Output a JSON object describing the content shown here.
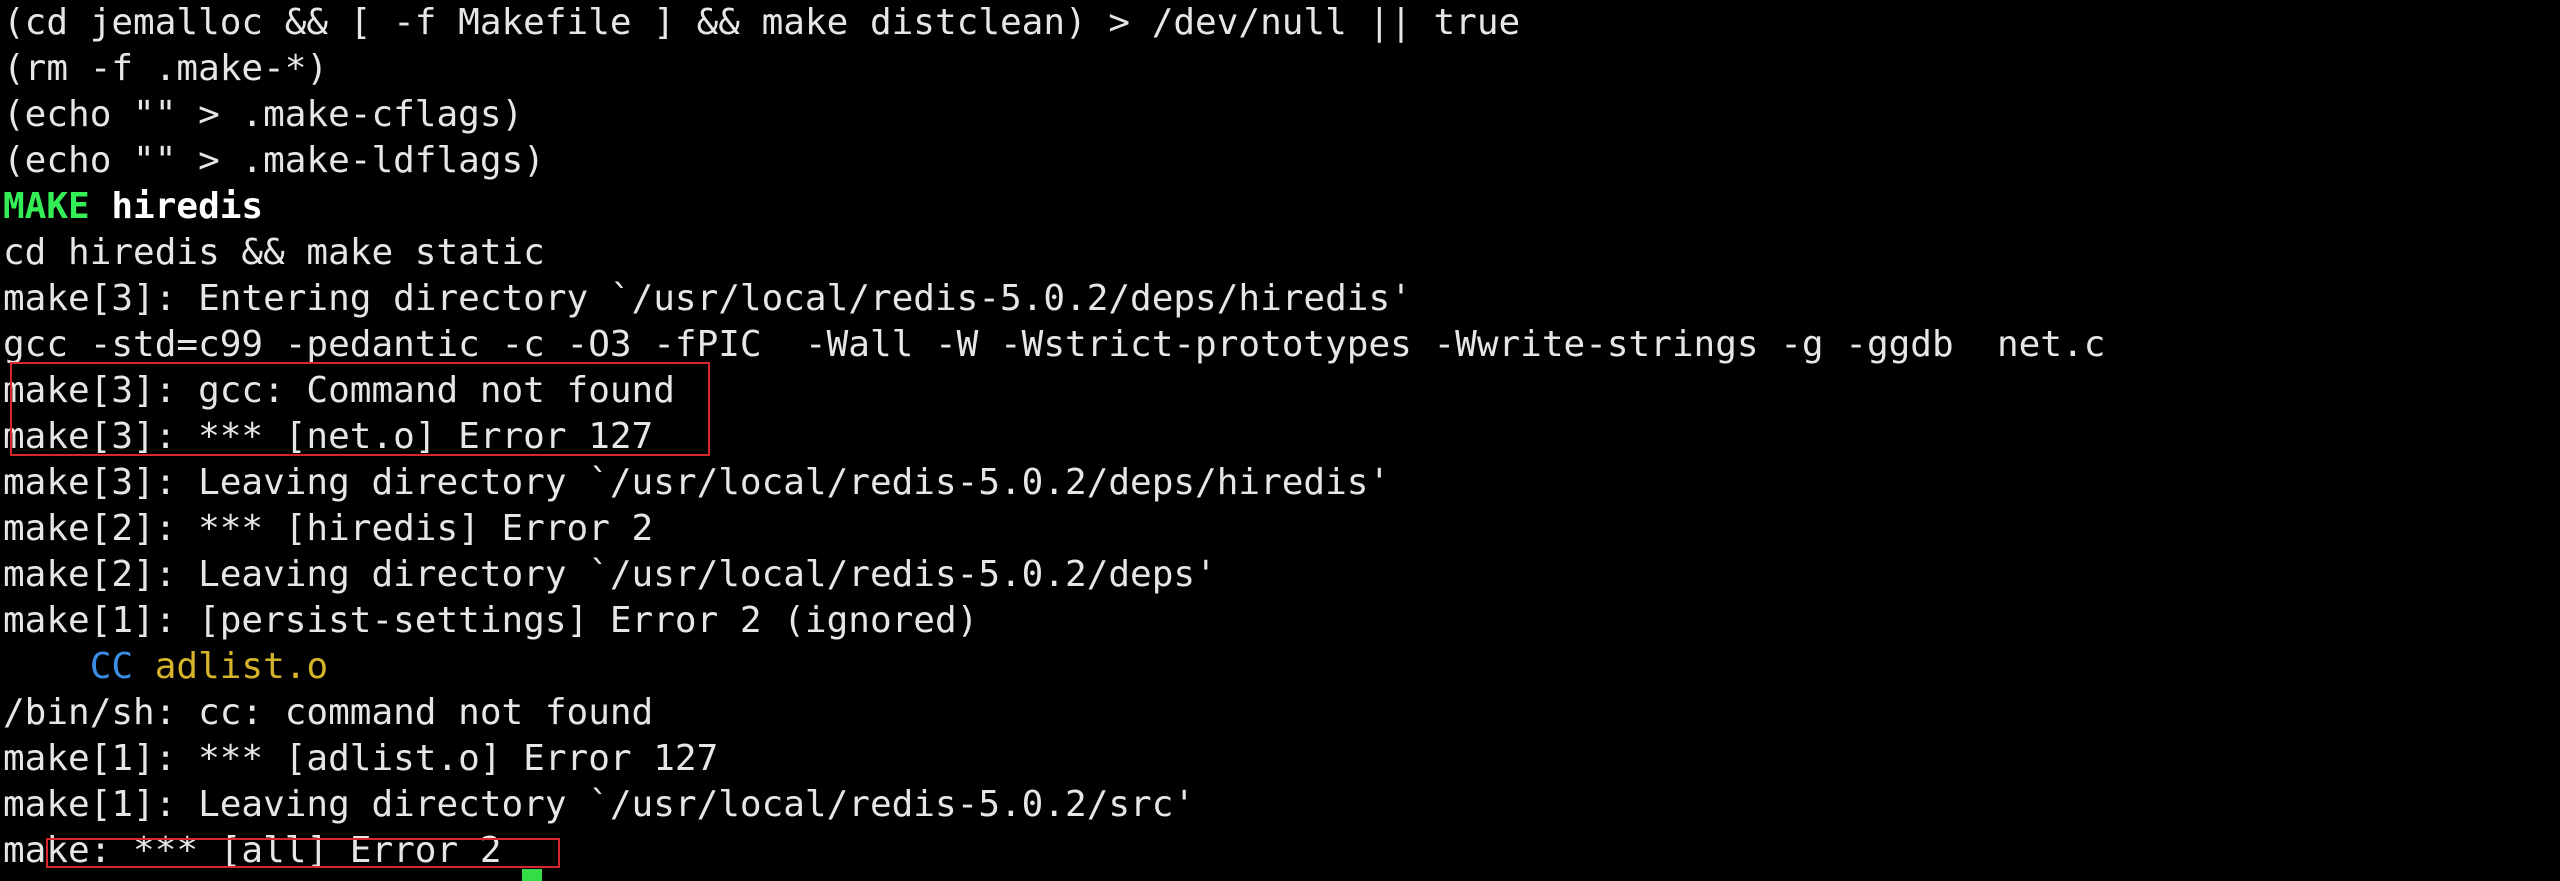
{
  "terminal": {
    "lines": [
      "(cd jemalloc && [ -f Makefile ] && make distclean) > /dev/null || true",
      "(rm -f .make-*)",
      "(echo \"\" > .make-cflags)",
      "(echo \"\" > .make-ldflags)",
      {
        "tag": "MAKE",
        "rest": " hiredis"
      },
      "cd hiredis && make static",
      "make[3]: Entering directory `/usr/local/redis-5.0.2/deps/hiredis'",
      "gcc -std=c99 -pedantic -c -O3 -fPIC  -Wall -W -Wstrict-prototypes -Wwrite-strings -g -ggdb  net.c",
      "make[3]: gcc: Command not found",
      "make[3]: *** [net.o] Error 127",
      "make[3]: Leaving directory `/usr/local/redis-5.0.2/deps/hiredis'",
      "make[2]: *** [hiredis] Error 2",
      "make[2]: Leaving directory `/usr/local/redis-5.0.2/deps'",
      "make[1]: [persist-settings] Error 2 (ignored)",
      {
        "indent": "    ",
        "cc": "CC",
        "obj": " adlist.o"
      },
      "/bin/sh: cc: command not found",
      "make[1]: *** [adlist.o] Error 127",
      "make[1]: Leaving directory `/usr/local/redis-5.0.2/src'",
      "make: *** [all] Error 2"
    ]
  },
  "colors": {
    "background": "#000000",
    "text": "#e6e6e6",
    "make_tag": "#33ee55",
    "cc_tag": "#3a8ee6",
    "object_file": "#d6b42a",
    "highlight_box": "#d9262c",
    "cursor": "#33dd44"
  }
}
